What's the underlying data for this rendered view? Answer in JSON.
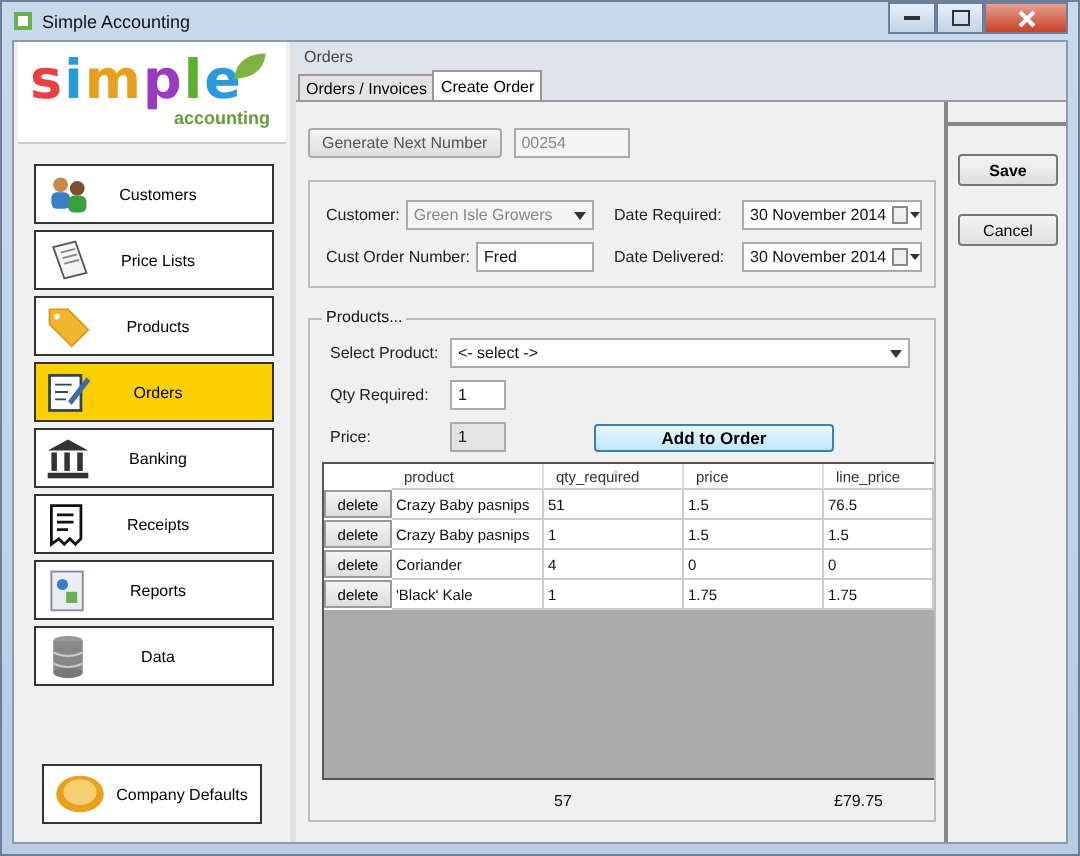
{
  "window": {
    "title": "Simple Accounting"
  },
  "logo": {
    "word": "simple",
    "sub": "accounting"
  },
  "sidebar": {
    "items": [
      {
        "label": "Customers",
        "selected": false
      },
      {
        "label": "Price Lists",
        "selected": false
      },
      {
        "label": "Products",
        "selected": false
      },
      {
        "label": "Orders",
        "selected": true
      },
      {
        "label": "Banking",
        "selected": false
      },
      {
        "label": "Receipts",
        "selected": false
      },
      {
        "label": "Reports",
        "selected": false
      },
      {
        "label": "Data",
        "selected": false
      }
    ],
    "footer_button": "Company Defaults"
  },
  "section_title": "Orders",
  "tabs": [
    {
      "label": "Orders / Invoices",
      "selected": false
    },
    {
      "label": "Create Order",
      "selected": true
    }
  ],
  "generate_button": "Generate Next Number",
  "order_number": {
    "value": "00254",
    "disabled": true
  },
  "customer": {
    "label": "Customer:",
    "value": "Green Isle Growers",
    "disabled": true
  },
  "cust_order_number": {
    "label": "Cust Order Number:",
    "value": "Fred"
  },
  "date_required": {
    "label": "Date Required:",
    "value": "30 November 2014"
  },
  "date_delivered": {
    "label": "Date Delivered:",
    "value": "30 November 2014"
  },
  "products": {
    "title": "Products...",
    "select_product": {
      "label": "Select Product:",
      "value": "<- select ->"
    },
    "qty_required": {
      "label": "Qty Required:",
      "value": "1"
    },
    "price": {
      "label": "Price:",
      "value": "1",
      "disabled": true
    },
    "add_button": "Add to Order",
    "table": {
      "columns": [
        "product",
        "qty_required",
        "price",
        "line_price"
      ],
      "rows": [
        {
          "action": "delete",
          "cells": [
            "Crazy Baby pasnips",
            "51",
            "1.5",
            "76.5"
          ]
        },
        {
          "action": "delete",
          "cells": [
            "Crazy Baby pasnips",
            "1",
            "1.5",
            "1.5"
          ]
        },
        {
          "action": "delete",
          "cells": [
            "Coriander",
            "4",
            "0",
            "0"
          ]
        },
        {
          "action": "delete",
          "cells": [
            "'Black' Kale",
            "1",
            "1.75",
            "1.75"
          ]
        }
      ]
    },
    "totals": {
      "qty": "57",
      "line_price": "£79.75"
    }
  },
  "buttons": [
    "Save",
    "Cancel"
  ]
}
